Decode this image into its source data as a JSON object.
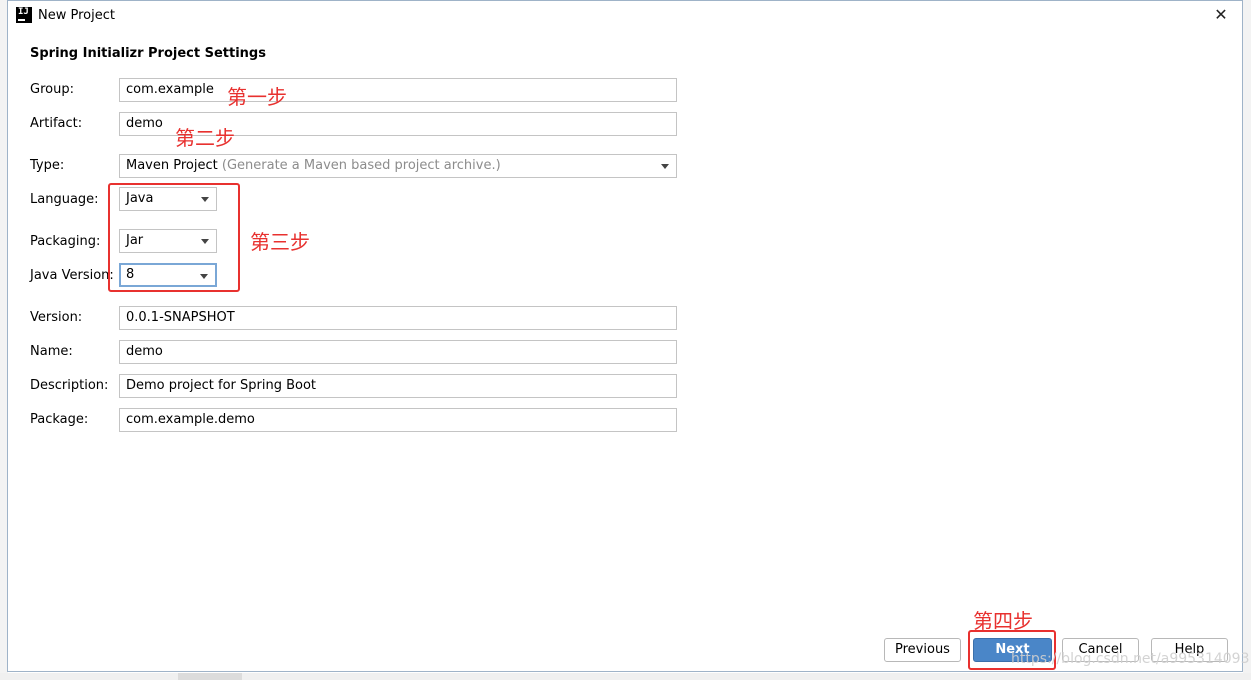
{
  "window": {
    "title": "New Project",
    "icon_text": "IJ"
  },
  "section_title": "Spring Initializr Project Settings",
  "fields": {
    "group": {
      "label": "Group:",
      "value": "com.example"
    },
    "artifact": {
      "label": "Artifact:",
      "value": "demo"
    },
    "type": {
      "label": "Type:",
      "value": "Maven Project",
      "hint": "(Generate a Maven based project archive.)"
    },
    "language": {
      "label": "Language:",
      "value": "Java"
    },
    "packaging": {
      "label": "Packaging:",
      "value": "Jar"
    },
    "java_version": {
      "label": "Java Version:",
      "value": "8"
    },
    "version": {
      "label": "Version:",
      "value": "0.0.1-SNAPSHOT"
    },
    "name": {
      "label": "Name:",
      "value": "demo"
    },
    "description": {
      "label": "Description:",
      "value": "Demo project for Spring Boot"
    },
    "package": {
      "label": "Package:",
      "value": "com.example.demo"
    }
  },
  "annotations": {
    "step1": "第一步",
    "step2": "第二步",
    "step3": "第三步",
    "step4": "第四步"
  },
  "buttons": {
    "previous": "Previous",
    "next": "Next",
    "cancel": "Cancel",
    "help": "Help"
  },
  "watermark": "https://blog.csdn.net/a995314093",
  "colors": {
    "annotation_red": "#e8312f",
    "primary_button": "#4a86c8",
    "focus_border": "#7aa7d6"
  }
}
